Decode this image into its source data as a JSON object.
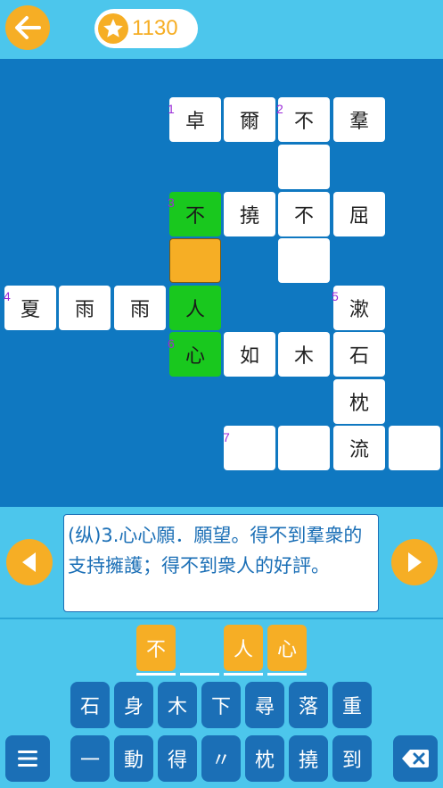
{
  "header": {
    "coins": "1130"
  },
  "board": {
    "cells": [
      {
        "id": "c-2-5",
        "ch": "卓",
        "state": "normal"
      },
      {
        "id": "c-2-6",
        "ch": "爾",
        "state": "normal"
      },
      {
        "id": "c-2-7",
        "ch": "不",
        "state": "normal"
      },
      {
        "id": "c-2-8",
        "ch": "羣",
        "state": "normal"
      },
      {
        "id": "c-3-7",
        "ch": "",
        "state": "normal"
      },
      {
        "id": "c-4-5",
        "ch": "不",
        "state": "green"
      },
      {
        "id": "c-4-6",
        "ch": "撓",
        "state": "normal"
      },
      {
        "id": "c-4-7",
        "ch": "不",
        "state": "normal"
      },
      {
        "id": "c-4-8",
        "ch": "屈",
        "state": "normal"
      },
      {
        "id": "c-5-5",
        "ch": "",
        "state": "orange"
      },
      {
        "id": "c-5-7",
        "ch": "",
        "state": "normal"
      },
      {
        "id": "c-6-2",
        "ch": "夏",
        "state": "normal"
      },
      {
        "id": "c-6-3",
        "ch": "雨",
        "state": "normal"
      },
      {
        "id": "c-6-4",
        "ch": "雨",
        "state": "normal"
      },
      {
        "id": "c-6-5",
        "ch": "人",
        "state": "green"
      },
      {
        "id": "c-6-8",
        "ch": "漱",
        "state": "normal"
      },
      {
        "id": "c-7-5",
        "ch": "心",
        "state": "green"
      },
      {
        "id": "c-7-6",
        "ch": "如",
        "state": "normal"
      },
      {
        "id": "c-7-7",
        "ch": "木",
        "state": "normal"
      },
      {
        "id": "c-7-8",
        "ch": "石",
        "state": "normal"
      },
      {
        "id": "c-8-8",
        "ch": "枕",
        "state": "normal"
      },
      {
        "id": "c-9-6",
        "ch": "",
        "state": "normal"
      },
      {
        "id": "c-9-7",
        "ch": "",
        "state": "normal"
      },
      {
        "id": "c-9-8",
        "ch": "流",
        "state": "normal"
      },
      {
        "id": "c-9-9",
        "ch": "",
        "state": "normal"
      }
    ],
    "numbers": [
      "1",
      "2",
      "3",
      "4",
      "5",
      "6",
      "7"
    ]
  },
  "clue": {
    "text": "(纵)3.心心願．願望。得不到羣衆的支持擁護；得不到衆人的好評。"
  },
  "answer": {
    "slots": [
      "不",
      "",
      "人",
      "心"
    ]
  },
  "keyboard": {
    "row1": [
      "石",
      "身",
      "木",
      "下",
      "尋",
      "落",
      "重"
    ],
    "row2": [
      "一",
      "動",
      "得",
      "〃",
      "枕",
      "撓",
      "到"
    ]
  },
  "colors": {
    "accent": "#f6ae25",
    "board": "#0f78c1",
    "highlight": "#19c81e",
    "key": "#1b6fb6",
    "background": "#4cc6ec"
  },
  "icons": {
    "back": "arrow-left-icon",
    "coin": "star-icon",
    "prev": "triangle-left-icon",
    "next": "triangle-right-icon",
    "menu": "menu-icon",
    "delete": "backspace-icon"
  }
}
